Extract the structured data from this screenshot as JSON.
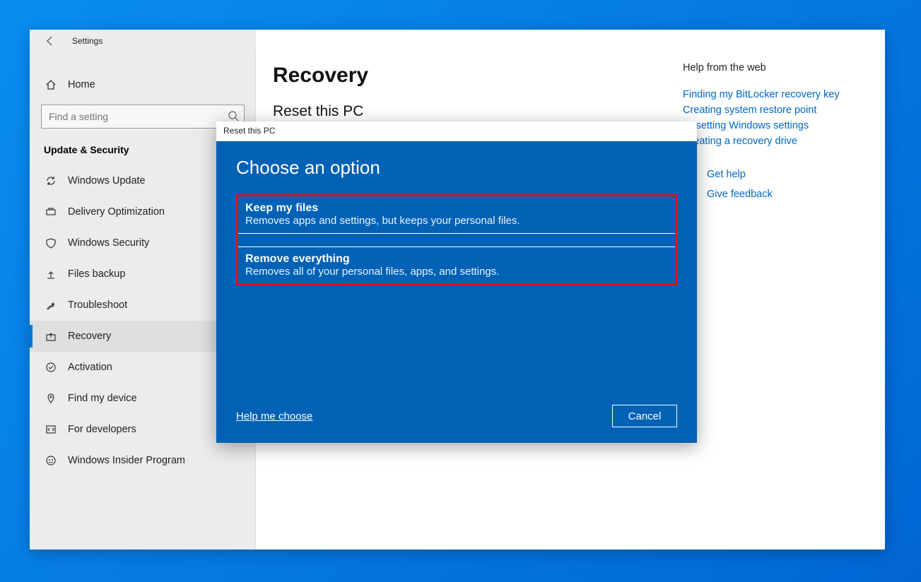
{
  "app_title": "Settings",
  "search": {
    "placeholder": "Find a setting"
  },
  "home_label": "Home",
  "category": "Update & Security",
  "nav": {
    "items": [
      {
        "label": "Windows Update"
      },
      {
        "label": "Delivery Optimization"
      },
      {
        "label": "Windows Security"
      },
      {
        "label": "Files backup"
      },
      {
        "label": "Troubleshoot"
      },
      {
        "label": "Recovery"
      },
      {
        "label": "Activation"
      },
      {
        "label": "Find my device"
      },
      {
        "label": "For developers"
      },
      {
        "label": "Windows Insider Program"
      }
    ],
    "active_index": 5
  },
  "page": {
    "title": "Recovery",
    "section": "Reset this PC"
  },
  "help": {
    "heading": "Help from the web",
    "links": [
      "Finding my BitLocker recovery key",
      "Creating system restore point",
      "Resetting Windows settings",
      "Creating a recovery drive"
    ],
    "get_help": "Get help",
    "give_feedback": "Give feedback"
  },
  "dialog": {
    "title": "Reset this PC",
    "heading": "Choose an option",
    "options": [
      {
        "title": "Keep my files",
        "desc": "Removes apps and settings, but keeps your personal files."
      },
      {
        "title": "Remove everything",
        "desc": "Removes all of your personal files, apps, and settings."
      }
    ],
    "help_link": "Help me choose",
    "cancel": "Cancel"
  }
}
